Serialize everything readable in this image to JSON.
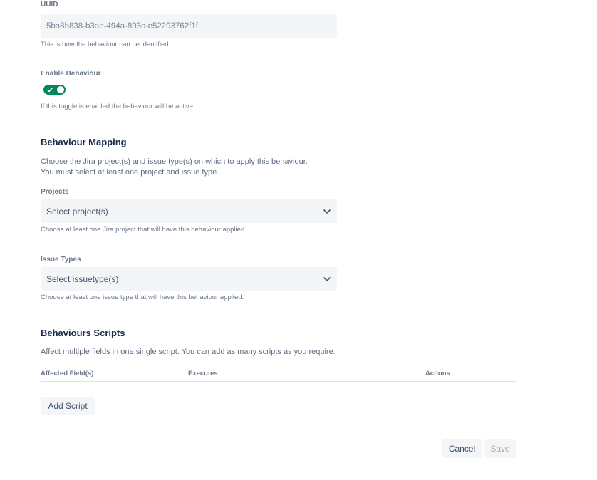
{
  "uuid": {
    "label": "UUID",
    "value": "5ba8b838-b3ae-494a-803c-e52293762f1f",
    "helper": "This is how the behaviour can be identified"
  },
  "enable": {
    "label": "Enable Behaviour",
    "state": "on",
    "helper": "If this toggle is enabled the behaviour will be active"
  },
  "mapping": {
    "heading": "Behaviour Mapping",
    "desc1": "Choose the Jira project(s) and issue type(s) on which to apply this behaviour.",
    "desc2": "You must select at least one project and issue type.",
    "projects": {
      "label": "Projects",
      "placeholder": "Select project(s)",
      "helper": "Choose at least one Jira project that will have this behaviour applied."
    },
    "issue_types": {
      "label": "Issue Types",
      "placeholder": "Select issuetype(s)",
      "helper": "Choose at least one issue type that will have this behaviour applied."
    }
  },
  "scripts": {
    "heading": "Behaviours Scripts",
    "desc": "Affect multiple fields in one single script. You can add as many scripts as you require.",
    "columns": [
      "Affected Field(s)",
      "Executes",
      "Actions"
    ],
    "add_label": "Add Script"
  },
  "footer": {
    "cancel_label": "Cancel",
    "save_label": "Save"
  },
  "colors": {
    "accent": "#00875a",
    "field_bg": "#f4f5f7",
    "text": "#172b4d",
    "subtle": "#6b778c"
  }
}
